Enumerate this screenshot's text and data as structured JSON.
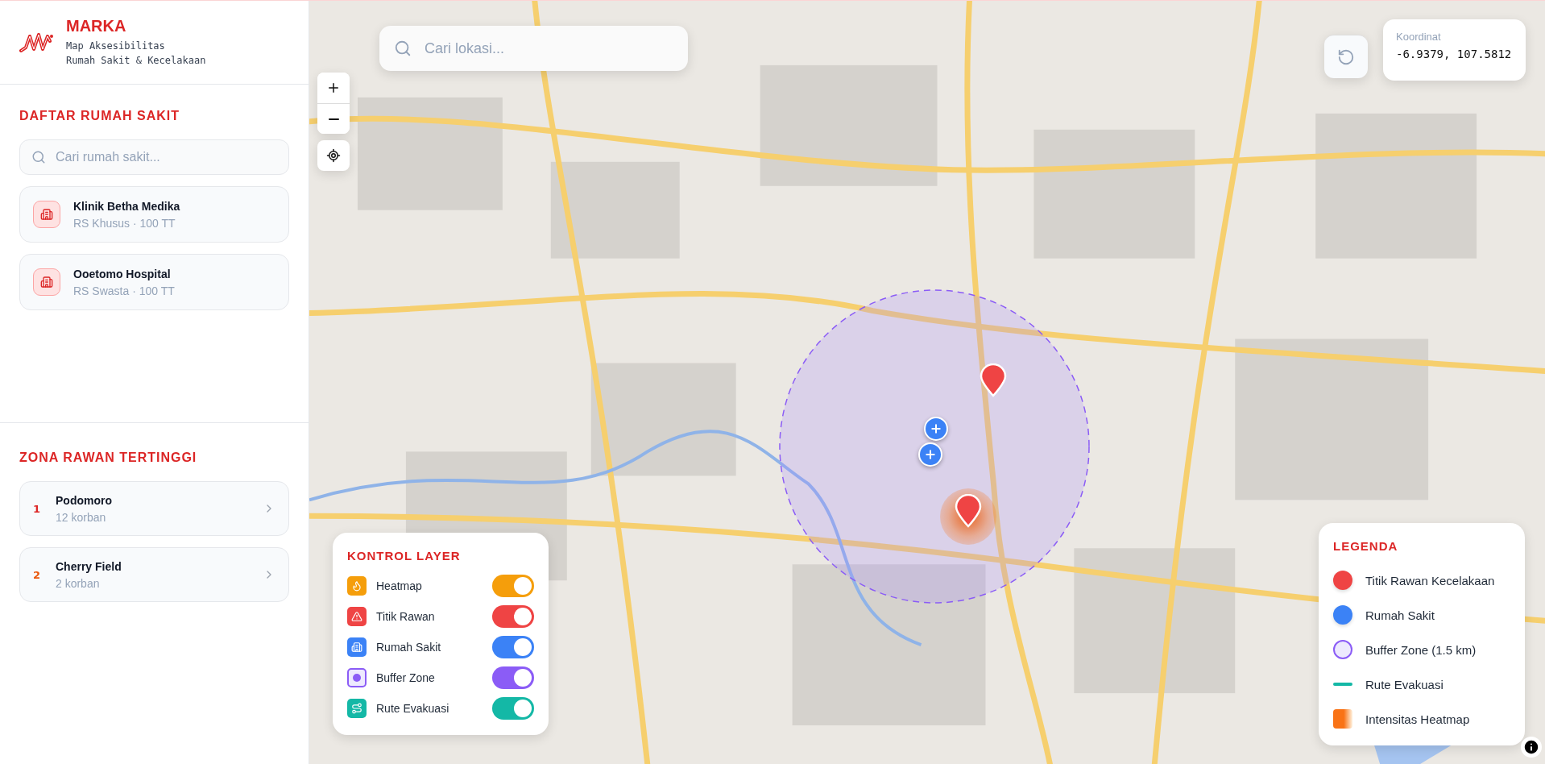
{
  "brand": {
    "name": "MARKA",
    "subtitle_lines": [
      "Map Aksesibilitas",
      "Rumah Sakit & Kecelakaan"
    ]
  },
  "hospital_section": {
    "title": "DAFTAR RUMAH SAKIT",
    "search": {
      "placeholder": "Cari rumah sakit..."
    },
    "items": [
      {
        "name": "Klinik Betha Medika",
        "meta": "RS Khusus · 100 TT"
      },
      {
        "name": "Ooetomo Hospital",
        "meta": "RS Swasta · 100 TT"
      }
    ]
  },
  "zone_section": {
    "title": "ZONA RAWAN TERTINGGI",
    "items": [
      {
        "rank": "1",
        "name": "Podomoro",
        "count": "12 korban",
        "color": "#dc2626"
      },
      {
        "rank": "2",
        "name": "Cherry Field",
        "count": "2 korban",
        "color": "#ea580c"
      }
    ]
  },
  "map": {
    "search": {
      "placeholder": "Cari lokasi..."
    },
    "coordinates": {
      "label": "Koordinat",
      "value": "-6.9379, 107.5812"
    },
    "layer_control": {
      "title": "KONTROL LAYER",
      "layers": [
        {
          "kind": "heatmap",
          "label": "Heatmap",
          "on": true,
          "color": "#f59e0b"
        },
        {
          "kind": "hazard",
          "label": "Titik Rawan",
          "on": true,
          "color": "#ef4444"
        },
        {
          "kind": "hospital",
          "label": "Rumah Sakit",
          "on": true,
          "color": "#3b82f6"
        },
        {
          "kind": "buffer",
          "label": "Buffer Zone",
          "on": true,
          "color": "#8b5cf6"
        },
        {
          "kind": "route",
          "label": "Rute Evakuasi",
          "on": true,
          "color": "#14b8a6"
        }
      ]
    },
    "legend": {
      "title": "LEGENDA",
      "items": [
        {
          "kind": "dot",
          "label": "Titik Rawan Kecelakaan",
          "color": "#ef4444"
        },
        {
          "kind": "dot",
          "label": "Rumah Sakit",
          "color": "#3b82f6"
        },
        {
          "kind": "ring",
          "label": "Buffer Zone (1.5 km)",
          "color": "#8b5cf6"
        },
        {
          "kind": "line",
          "label": "Rute Evakuasi",
          "color": "#14b8a6"
        },
        {
          "kind": "gradient",
          "label": "Intensitas Heatmap",
          "color": "#f97316"
        }
      ]
    }
  }
}
